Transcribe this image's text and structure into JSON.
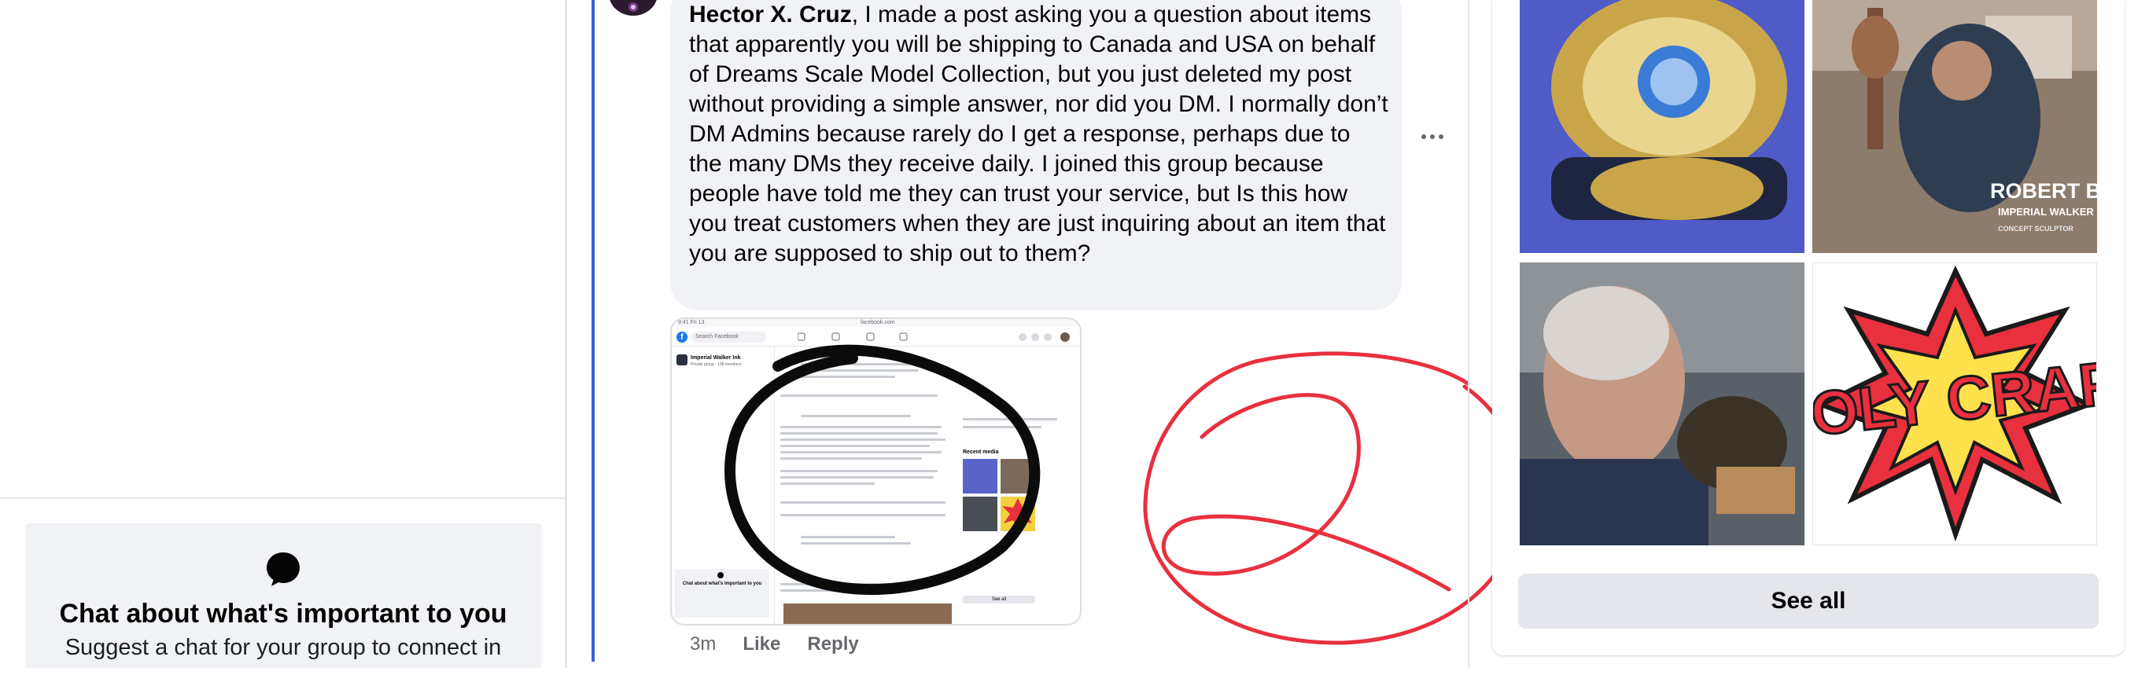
{
  "comment": {
    "author": "Hector X. Cruz",
    "text": ", I made a post asking you a question about items that apparently you will be shipping to Canada and USA on behalf of Dreams Scale Model Collection, but you just deleted my post without providing a simple answer, nor did you DM. I normally don’t DM Admins because rarely do I get a response, perhaps due to the many DMs they receive daily. I joined this group because people have told me they can trust your service, but Is this how you treat customers when they are just inquiring about an item that you are supposed to ship out to them?",
    "more_options_icon": "more-dots-icon",
    "time": "3m",
    "like_label": "Like",
    "reply_label": "Reply"
  },
  "attachment": {
    "status_left": "9:41 Fri 13",
    "status_center": "facebook.com",
    "search_placeholder": "Search Facebook",
    "group_name": "Imperial Walker Ink",
    "group_meta": "Private group · 198 members",
    "chat_title": "Chat about what's important to you",
    "recent_media": "Recent media",
    "see_all": "See all"
  },
  "left_panel": {
    "chat_icon": "chat-bubble-icon",
    "chat_title": "Chat about what's important to you",
    "chat_subtitle": "Suggest a chat for your group to connect in"
  },
  "media_panel": {
    "tiles": [
      {
        "name": "championship-belt-photo"
      },
      {
        "name": "sculptor-at-work-photo",
        "caption_name": "ROBERT BARI",
        "caption_role": "IMPERIAL WALKER IN",
        "caption_extra": "CONCEPT SCULPTOR"
      },
      {
        "name": "sculptor-closeup-photo"
      },
      {
        "name": "holy-crap-graphic",
        "text": "HOLY CRAP!"
      }
    ],
    "see_all_label": "See all"
  },
  "colors": {
    "thread_line": "#3b5fd9",
    "annotation_red": "#e8303e",
    "bubble_bg": "#f0f2f5"
  }
}
